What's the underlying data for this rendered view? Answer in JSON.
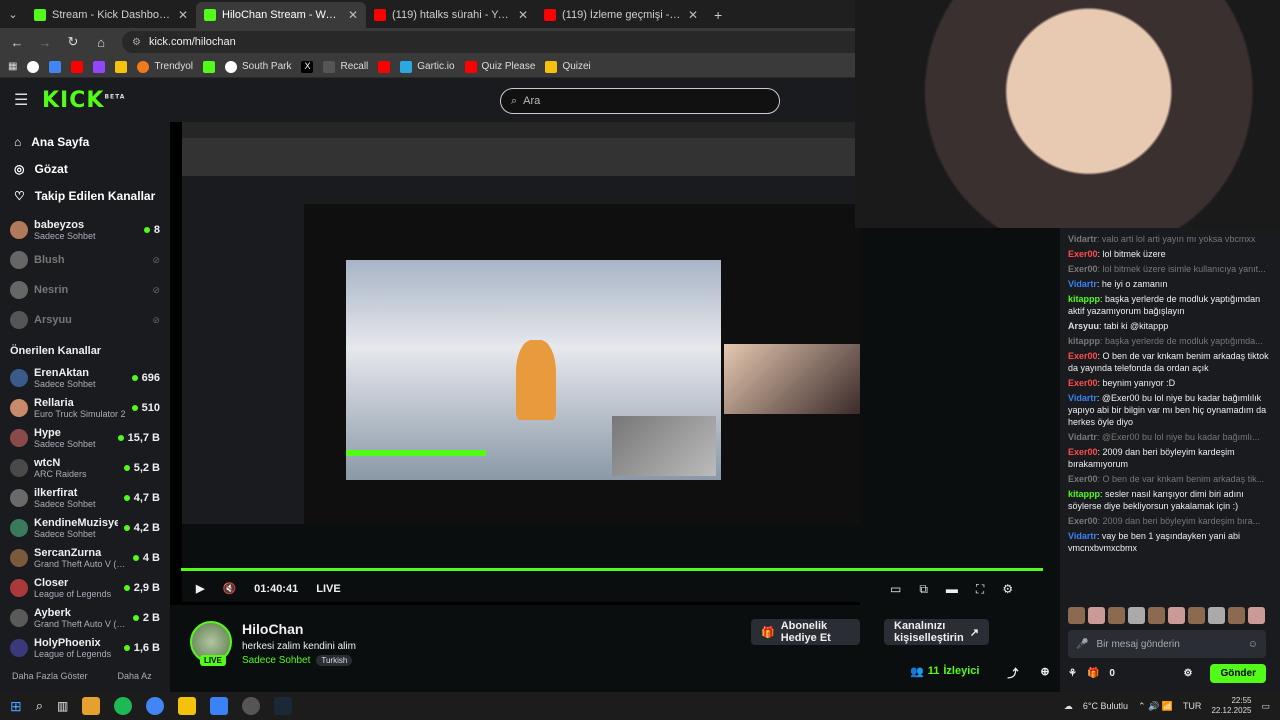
{
  "browser": {
    "tabs": [
      {
        "title": "Stream - Kick Dashboard",
        "color": "#53fc18"
      },
      {
        "title": "HiloChan Stream - Watch Live o",
        "color": "#53fc18"
      },
      {
        "title": "(119) htalks sürahi - YouTube",
        "color": "#ff0000"
      },
      {
        "title": "(119) İzleme geçmişi - YouTube",
        "color": "#ff0000"
      }
    ],
    "url": "kick.com/hilochan",
    "bookmarks": [
      "Trendyol",
      "South Park",
      "Recall",
      "Gartic.io",
      "Quiz Please",
      "Quizei"
    ]
  },
  "header": {
    "logo": "KICK",
    "beta": "BETA",
    "search_placeholder": "Ara"
  },
  "sidebar": {
    "nav": [
      {
        "label": "Ana Sayfa"
      },
      {
        "label": "Gözat"
      },
      {
        "label": "Takip Edilen Kanallar"
      }
    ],
    "followed": [
      {
        "name": "babeyzos",
        "sub": "Sadece Sohbet",
        "viewers": "8",
        "live": true
      },
      {
        "name": "Blush",
        "sub": "",
        "viewers": "",
        "live": false
      },
      {
        "name": "Nesrin",
        "sub": "",
        "viewers": "",
        "live": false
      },
      {
        "name": "Arsyuu",
        "sub": "",
        "viewers": "",
        "live": false
      }
    ],
    "recommended_title": "Önerilen Kanallar",
    "recommended": [
      {
        "name": "ErenAktan",
        "sub": "Sadece Sohbet",
        "viewers": "696"
      },
      {
        "name": "Rellaria",
        "sub": "Euro Truck Simulator 2",
        "viewers": "510"
      },
      {
        "name": "Hype",
        "sub": "Sadece Sohbet",
        "viewers": "15,7 B"
      },
      {
        "name": "wtcN",
        "sub": "ARC Raiders",
        "viewers": "5,2 B"
      },
      {
        "name": "ilkerfirat",
        "sub": "Sadece Sohbet",
        "viewers": "4,7 B"
      },
      {
        "name": "KendineMuzisyen",
        "sub": "Sadece Sohbet",
        "viewers": "4,2 B"
      },
      {
        "name": "SercanZurna",
        "sub": "Grand Theft Auto V (G...",
        "viewers": "4 B"
      },
      {
        "name": "Closer",
        "sub": "League of Legends",
        "viewers": "2,9 B"
      },
      {
        "name": "Ayberk",
        "sub": "Grand Theft Auto V (G...",
        "viewers": "2 B"
      },
      {
        "name": "HolyPhoenix",
        "sub": "League of Legends",
        "viewers": "1,6 B"
      }
    ],
    "show_more": "Daha Fazla Göster",
    "show_less": "Daha Az"
  },
  "player": {
    "time": "01:40:41",
    "live": "LIVE"
  },
  "stream": {
    "name": "HiloChan",
    "title": "herkesi zalim kendini alim",
    "category": "Sadece Sohbet",
    "language": "Turkish",
    "live_badge": "LIVE",
    "gift_button": "Abonelik Hediye Et",
    "customize_button": "Kanalınızı kişiselleştirin",
    "viewer_count": "11",
    "viewer_label": "İzleyici"
  },
  "chat": {
    "messages": [
      {
        "user": "Vidartr",
        "text": "valo arti lol arti yayın mı yoksa vbcmxx",
        "dim": true
      },
      {
        "user": "Exer00",
        "text": "lol bitmek üzere",
        "color": "#ff4b4b"
      },
      {
        "user": "Exer00",
        "text": "lol bitmek üzere isimle kullanıcıya yanıt...",
        "dim": true
      },
      {
        "user": "Vidartr",
        "text": "he iyi o zamanın",
        "color": "#3b82f6"
      },
      {
        "user": "kitappp",
        "text": "başka yerlerde de modluk yaptığımdan aktif yazamıyorum bağışlayın",
        "color": "#53fc18"
      },
      {
        "user": "Arsyuu",
        "text": "tabi ki @kitappp",
        "color": "#ddd"
      },
      {
        "user": "kitappp",
        "text": "başka yerlerde de modluk yaptığımda...",
        "dim": true
      },
      {
        "user": "Exer00",
        "text": "O ben de var knkam benim arkadaş tiktok da yayında telefonda da ordan açık",
        "color": "#ff4b4b"
      },
      {
        "user": "Exer00",
        "text": "beynim yanıyor :D",
        "color": "#ff4b4b"
      },
      {
        "user": "Vidartr",
        "text": "@Exer00 bu lol niye bu kadar bağımlılık yapıyo abi bir bilgin var mı ben hiç oynamadım da herkes öyle diyo",
        "color": "#3b82f6"
      },
      {
        "user": "Vidartr",
        "text": "@Exer00 bu lol niye bu kadar bağımlı...",
        "dim": true
      },
      {
        "user": "Exer00",
        "text": "2009 dan beri böyleyim kardeşim bırakamıyorum",
        "color": "#ff4b4b"
      },
      {
        "user": "Exer00",
        "text": "O ben de var knkam benim arkadaş tik...",
        "dim": true
      },
      {
        "user": "kitappp",
        "text": "sesler nasıl karışıyor dimi biri adını söylerse diye bekliyorsun yakalamak için :)",
        "color": "#53fc18"
      },
      {
        "user": "Exer00",
        "text": "2009 dan beri böyleyim kardeşim bıra...",
        "dim": true
      },
      {
        "user": "Vidartr",
        "text": "vay be ben 1 yaşındayken yani abi vmcnxbvmxcbmx",
        "color": "#3b82f6"
      }
    ],
    "input_placeholder": "Bir mesaj gönderin",
    "points": "0",
    "send": "Gönder"
  },
  "taskbar": {
    "weather": "6°C  Bulutlu",
    "lang": "TUR",
    "time": "22:55",
    "date": "22.12.2025"
  }
}
